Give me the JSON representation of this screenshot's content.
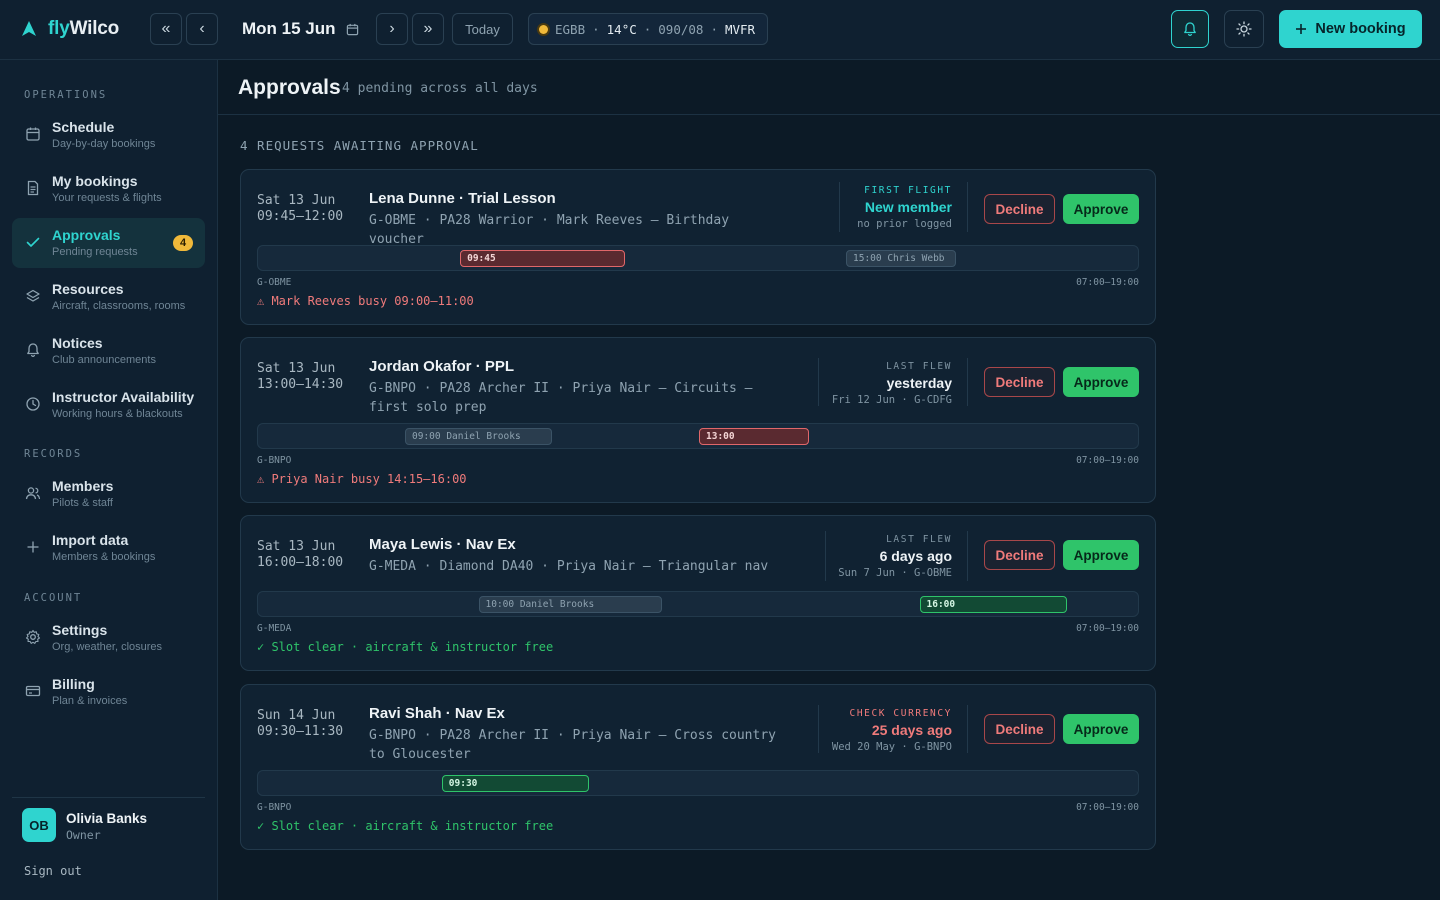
{
  "app": {
    "brand_fly": "fly",
    "brand_wilco": "Wilco"
  },
  "topbar": {
    "nav_first": "«",
    "nav_prev": "‹",
    "date": "Mon 15 Jun",
    "nav_next": "›",
    "nav_last": "»",
    "today": "Today",
    "weather": {
      "station": "EGBB",
      "sep": "·",
      "temp": "14°C",
      "wind": "090/08",
      "category": "MVFR"
    },
    "new_booking": "New booking"
  },
  "sidebar": {
    "sections": {
      "operations": "OPERATIONS",
      "records": "RECORDS",
      "account": "ACCOUNT"
    },
    "items": [
      {
        "title": "Schedule",
        "sub": "Day-by-day bookings",
        "icon": "calendar-icon"
      },
      {
        "title": "My bookings",
        "sub": "Your requests & flights",
        "icon": "document-icon"
      },
      {
        "title": "Approvals",
        "sub": "Pending requests",
        "icon": "check-icon",
        "badge": "4",
        "active": true
      },
      {
        "title": "Resources",
        "sub": "Aircraft, classrooms, rooms",
        "icon": "layers-icon"
      },
      {
        "title": "Notices",
        "sub": "Club announcements",
        "icon": "bell-icon"
      },
      {
        "title": "Instructor Availability",
        "sub": "Working hours & blackouts",
        "icon": "clock-icon"
      },
      {
        "title": "Members",
        "sub": "Pilots & staff",
        "icon": "users-icon"
      },
      {
        "title": "Import data",
        "sub": "Members & bookings",
        "icon": "plus-icon"
      },
      {
        "title": "Settings",
        "sub": "Org, weather, closures",
        "icon": "gear-icon"
      },
      {
        "title": "Billing",
        "sub": "Plan & invoices",
        "icon": "card-icon"
      }
    ],
    "user": {
      "initials": "OB",
      "name": "Olivia Banks",
      "role": "Owner",
      "sign_out": "Sign out"
    }
  },
  "main": {
    "title": "Approvals",
    "subtitle": "4 pending across all days",
    "list_label": "4 REQUESTS AWAITING APPROVAL",
    "decline_label": "Decline",
    "approve_label": "Approve",
    "hours_label": "07:00–19:00",
    "requests": [
      {
        "date": "Sat 13 Jun",
        "time": "09:45–12:00",
        "who": "Lena Dunne · Trial Lesson",
        "detail": "G-OBME · PA28 Warrior · Mark Reeves — Birthday voucher",
        "meta_label": "FIRST FLIGHT",
        "meta_value": "New member",
        "meta_small": "no prior logged",
        "meta_tone": "accent",
        "reg": "G-OBME",
        "blocks": [
          {
            "label": "09:45",
            "kind": "conflict",
            "start": "09:45",
            "end": "12:00"
          },
          {
            "label": "15:00 Chris Webb",
            "kind": "other",
            "start": "15:00",
            "end": "16:30"
          }
        ],
        "status": "⚠ Mark Reeves busy 09:00–11:00",
        "status_kind": "warn"
      },
      {
        "date": "Sat 13 Jun",
        "time": "13:00–14:30",
        "who": "Jordan Okafor · PPL",
        "detail": "G-BNPO · PA28 Archer II · Priya Nair — Circuits — first solo prep",
        "meta_label": "LAST FLEW",
        "meta_value": "yesterday",
        "meta_small": "Fri 12 Jun · G-CDFG",
        "meta_tone": "plain",
        "reg": "G-BNPO",
        "blocks": [
          {
            "label": "09:00 Daniel Brooks",
            "kind": "other",
            "start": "09:00",
            "end": "11:00"
          },
          {
            "label": "13:00",
            "kind": "conflict",
            "start": "13:00",
            "end": "14:30"
          }
        ],
        "status": "⚠ Priya Nair busy 14:15–16:00",
        "status_kind": "warn"
      },
      {
        "date": "Sat 13 Jun",
        "time": "16:00–18:00",
        "who": "Maya Lewis · Nav Ex",
        "detail": "G-MEDA · Diamond DA40 · Priya Nair — Triangular nav",
        "meta_label": "LAST FLEW",
        "meta_value": "6 days ago",
        "meta_small": "Sun 7 Jun · G-OBME",
        "meta_tone": "plain",
        "reg": "G-MEDA",
        "blocks": [
          {
            "label": "10:00 Daniel Brooks",
            "kind": "other",
            "start": "10:00",
            "end": "12:30"
          },
          {
            "label": "16:00",
            "kind": "ok",
            "start": "16:00",
            "end": "18:00"
          }
        ],
        "status": "✓ Slot clear · aircraft & instructor free",
        "status_kind": "good"
      },
      {
        "date": "Sun 14 Jun",
        "time": "09:30–11:30",
        "who": "Ravi Shah · Nav Ex",
        "detail": "G-BNPO · PA28 Archer II · Priya Nair — Cross country to Gloucester",
        "meta_label": "CHECK CURRENCY",
        "meta_value": "25 days ago",
        "meta_small": "Wed 20 May · G-BNPO",
        "meta_tone": "warn",
        "reg": "G-BNPO",
        "blocks": [
          {
            "label": "09:30",
            "kind": "ok",
            "start": "09:30",
            "end": "11:30"
          }
        ],
        "status": "✓ Slot clear · aircraft & instructor free",
        "status_kind": "good"
      }
    ]
  },
  "colors": {
    "accent": "#2fd4cf",
    "approve": "#2fc46a",
    "decline": "#f07b7b",
    "warn": "#f0b93a"
  }
}
